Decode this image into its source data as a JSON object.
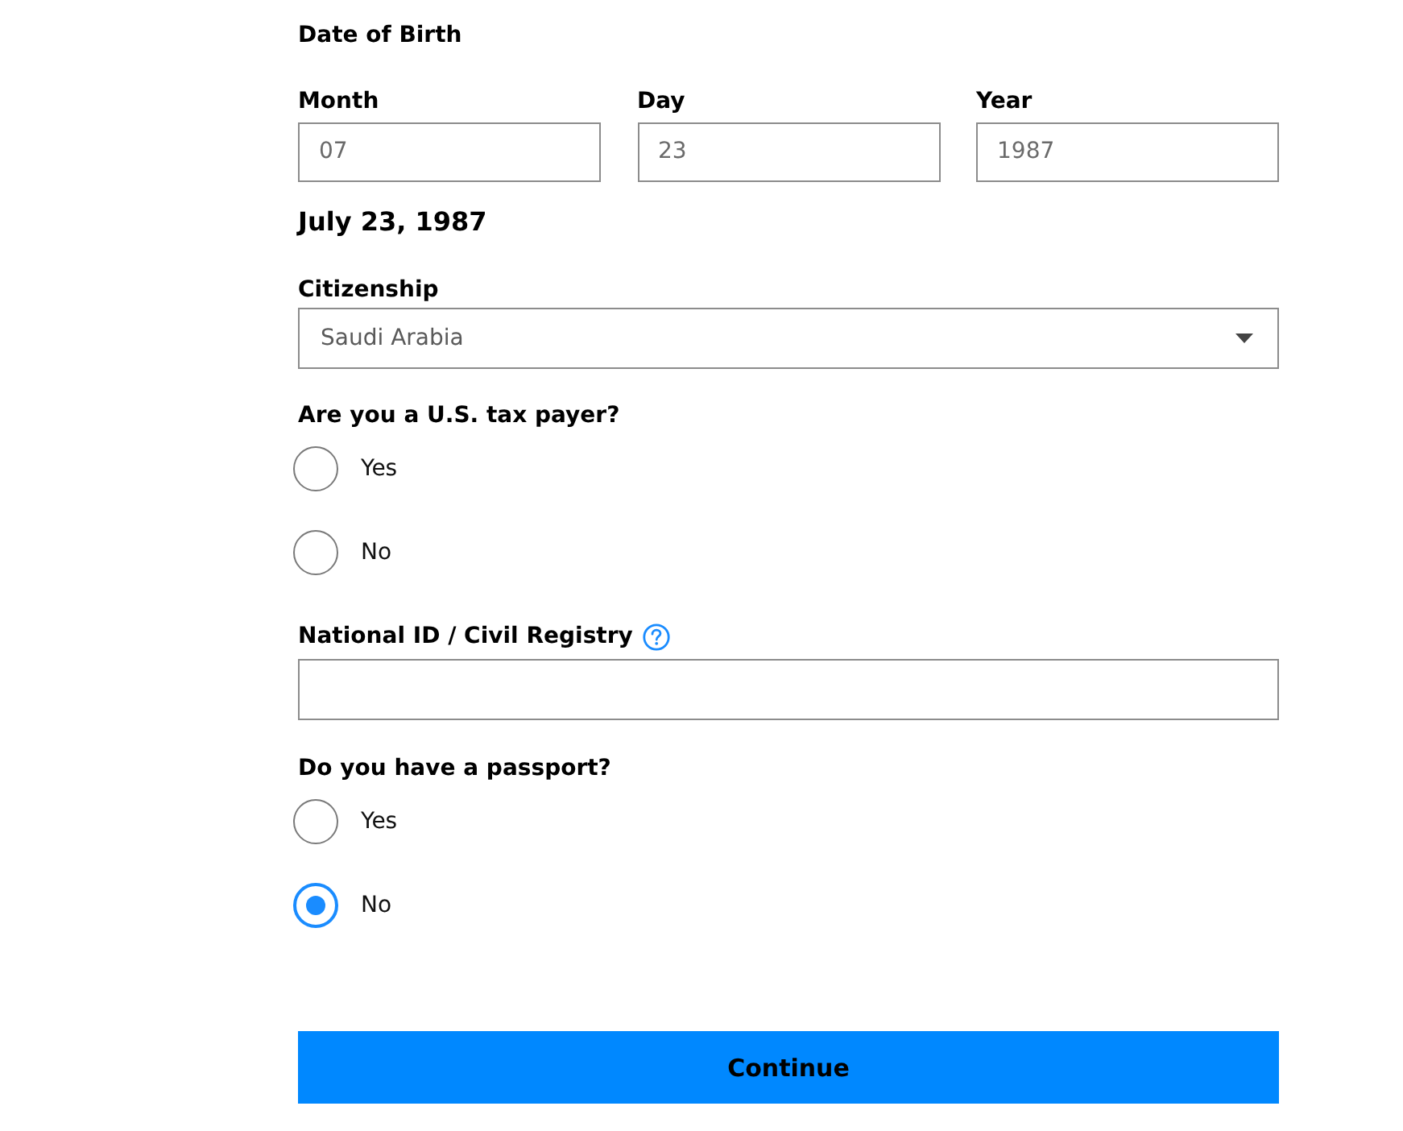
{
  "date_of_birth": {
    "title": "Date of Birth",
    "fields": [
      {
        "label": "Month",
        "value": "07"
      },
      {
        "label": "Day",
        "value": "23"
      },
      {
        "label": "Year",
        "value": "1987"
      }
    ],
    "summary": "July 23, 1987"
  },
  "citizenship": {
    "label": "Citizenship",
    "value": "Saudi Arabia"
  },
  "tax_payer": {
    "question": "Are you a U.S. tax payer?",
    "options": [
      {
        "label": "Yes",
        "selected": false
      },
      {
        "label": "No",
        "selected": false
      }
    ]
  },
  "national_id": {
    "label": "National ID / Civil Registry"
  },
  "passport": {
    "question": "Do you have a passport?",
    "options": [
      {
        "label": "Yes",
        "selected": false
      },
      {
        "label": "No",
        "selected": true
      }
    ]
  },
  "continue_button": {
    "label": "Continue"
  }
}
